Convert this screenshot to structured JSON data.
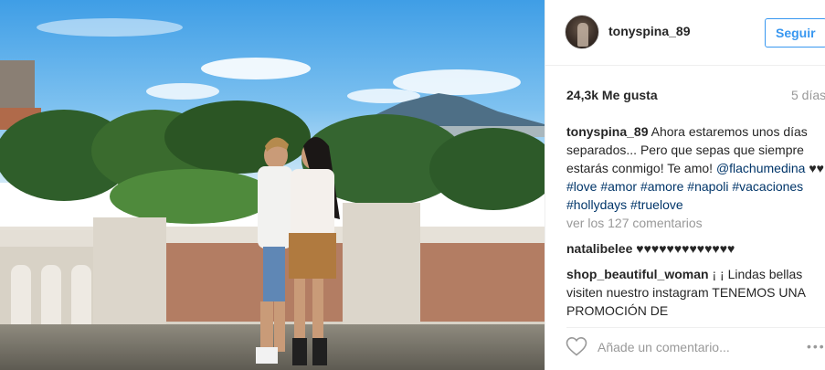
{
  "header": {
    "username": "tonyspina_89",
    "follow_label": "Seguir"
  },
  "stats": {
    "likes": "24,3k Me gusta",
    "time": "5 días"
  },
  "caption": {
    "username": "tonyspina_89",
    "text_part1": " Ahora estaremos unos días separados... Pero que sepas que siempre estarás conmigo! Te amo! ",
    "mention": "@flachumedina",
    "hearts": " ♥♥ ",
    "tags": [
      "#love",
      "#amor",
      "#amore",
      "#napoli",
      "#vacaciones",
      "#hollydays",
      "#truelove"
    ]
  },
  "more_comments": "ver los 127 comentarios",
  "comments": [
    {
      "username": "natalibelee",
      "text": " ♥♥♥♥♥♥♥♥♥♥♥♥♥"
    },
    {
      "username": "shop_beautiful_woman",
      "text": " ¡ ¡ Lindas bellas visiten nuestro instagram TENEMOS UNA PROMOCIÓN DE"
    }
  ],
  "actions": {
    "comment_placeholder": "Añade un comentario...",
    "options_label": "•••"
  },
  "colors": {
    "accent": "#3897f0",
    "link": "#003569",
    "muted": "#999999",
    "border": "#efefef"
  },
  "icons": {
    "like": "heart-outline-icon",
    "options": "ellipsis-icon"
  }
}
